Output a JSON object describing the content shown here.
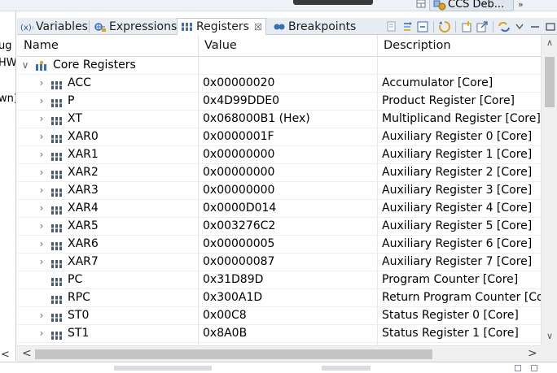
{
  "perspective": {
    "label": "CCS Deb...",
    "more_label": "»"
  },
  "left_fragment": {
    "lines": [
      "ug",
      "HW",
      "",
      "wn)"
    ]
  },
  "tabs": [
    {
      "label": "Variables",
      "icon": "variables-icon"
    },
    {
      "label": "Expressions",
      "icon": "expressions-icon"
    },
    {
      "label": "Registers",
      "icon": "registers-icon",
      "active": true,
      "close": "☒"
    },
    {
      "label": "Breakpoints",
      "icon": "breakpoints-icon"
    }
  ],
  "columns": {
    "name": "Name",
    "value": "Value",
    "description": "Description"
  },
  "group": {
    "label": "Core Registers",
    "expander": "∨"
  },
  "rows": [
    {
      "name": "ACC",
      "value": "0x00000020",
      "description": "Accumulator [Core]",
      "expandable": true
    },
    {
      "name": "P",
      "value": "0x4D99DDE0",
      "description": "Product Register [Core]",
      "expandable": true
    },
    {
      "name": "XT",
      "value": "0x068000B1 (Hex)",
      "description": "Multiplicand Register [Core]",
      "expandable": true
    },
    {
      "name": "XAR0",
      "value": "0x0000001F",
      "description": "Auxiliary Register 0 [Core]",
      "expandable": true
    },
    {
      "name": "XAR1",
      "value": "0x00000000",
      "description": "Auxiliary Register 1 [Core]",
      "expandable": true
    },
    {
      "name": "XAR2",
      "value": "0x00000000",
      "description": "Auxiliary Register 2 [Core]",
      "expandable": true
    },
    {
      "name": "XAR3",
      "value": "0x00000000",
      "description": "Auxiliary Register 3 [Core]",
      "expandable": true
    },
    {
      "name": "XAR4",
      "value": "0x0000D014",
      "description": "Auxiliary Register 4 [Core]",
      "expandable": true
    },
    {
      "name": "XAR5",
      "value": "0x003276C2",
      "description": "Auxiliary Register 5 [Core]",
      "expandable": true
    },
    {
      "name": "XAR6",
      "value": "0x00000005",
      "description": "Auxiliary Register 6 [Core]",
      "expandable": true
    },
    {
      "name": "XAR7",
      "value": "0x00000087",
      "description": "Auxiliary Register 7 [Core]",
      "expandable": true
    },
    {
      "name": "PC",
      "value": "0x31D89D",
      "description": "Program Counter [Core]",
      "expandable": false
    },
    {
      "name": "RPC",
      "value": "0x300A1D",
      "description": "Return Program Counter [Co",
      "expandable": false
    },
    {
      "name": "ST0",
      "value": "0x00C8",
      "description": "Status Register 0 [Core]",
      "expandable": true
    },
    {
      "name": "ST1",
      "value": "0x8A0B",
      "description": "Status Register 1 [Core]",
      "expandable": true
    }
  ],
  "glyphs": {
    "expand": "›",
    "scroll_up": "∧",
    "scroll_down": "∨",
    "scroll_left": "<",
    "scroll_right": ">"
  },
  "colors": {
    "accent_yellow": "#d8a321",
    "accent_blue": "#3a6fb0",
    "tab_bar_bg": "#e8edf3"
  }
}
